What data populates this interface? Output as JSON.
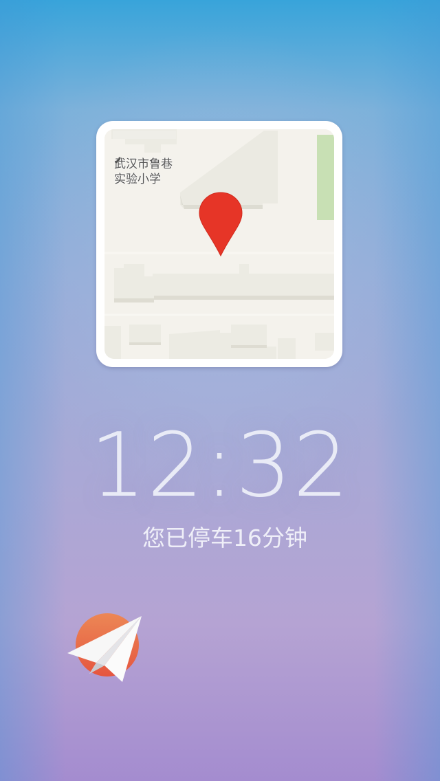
{
  "map": {
    "poi_label_line1": "武汉市鲁巷",
    "poi_label_line2": "实验小学",
    "pin_color": "#e63527",
    "park_color": "#c8e0b4",
    "building_color": "#ecebe3",
    "pin_icon": "location-pin-icon",
    "poi_icon": "school-poi-icon"
  },
  "clock": {
    "time": "12:32"
  },
  "status": {
    "parking_text": "您已停车16分钟"
  },
  "app_button": {
    "icon": "paper-plane-icon",
    "accent_color": "#ea6a49"
  }
}
